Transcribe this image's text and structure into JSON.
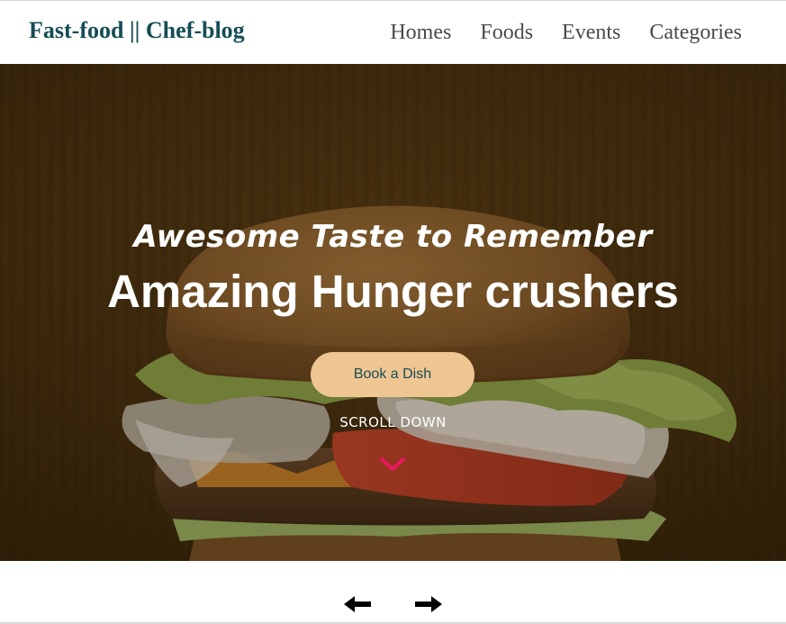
{
  "brand": {
    "title": "Fast-food || Chef-blog",
    "color": "#164d55"
  },
  "nav": {
    "items": [
      "Homes",
      "Foods",
      "Events",
      "Categories"
    ]
  },
  "hero": {
    "subtitle": "Awesome Taste to Remember",
    "title": "Amazing Hunger crushers",
    "book_button": "Book a Dish",
    "scroll_label": "SCROLL DOWN",
    "background": "burger-photo",
    "scroll_icon": "chevron-down-icon",
    "accent_color": "#e8185f",
    "button_color": "#efc592"
  },
  "slider": {
    "prev_icon": "arrow-left-icon",
    "next_icon": "arrow-right-icon"
  }
}
